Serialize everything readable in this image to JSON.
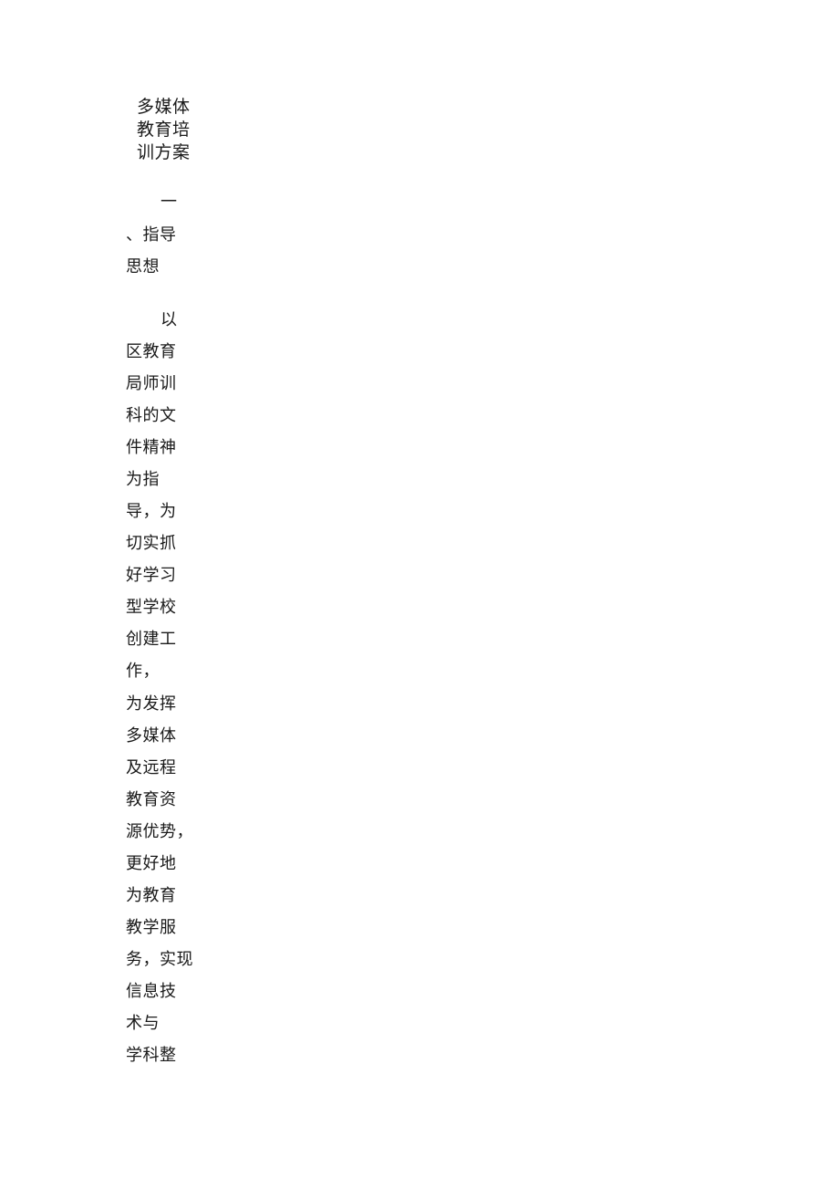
{
  "document": {
    "title_lines": [
      "多媒体",
      "教育培",
      "训方案"
    ],
    "section_heading_lines": [
      "一",
      "、指导",
      "思想"
    ],
    "body_lines": [
      "以",
      "区教育",
      "局师训",
      "科的文",
      "件精神",
      "为指",
      "导，为",
      "切实抓",
      "好学习",
      "型学校",
      "创建工",
      "作，",
      "为发挥",
      "多媒体",
      "及远程",
      "教育资",
      "源优势，",
      "更好地",
      "为教育",
      "教学服",
      "务，实现",
      "信息技",
      "术与",
      "学科整"
    ]
  }
}
